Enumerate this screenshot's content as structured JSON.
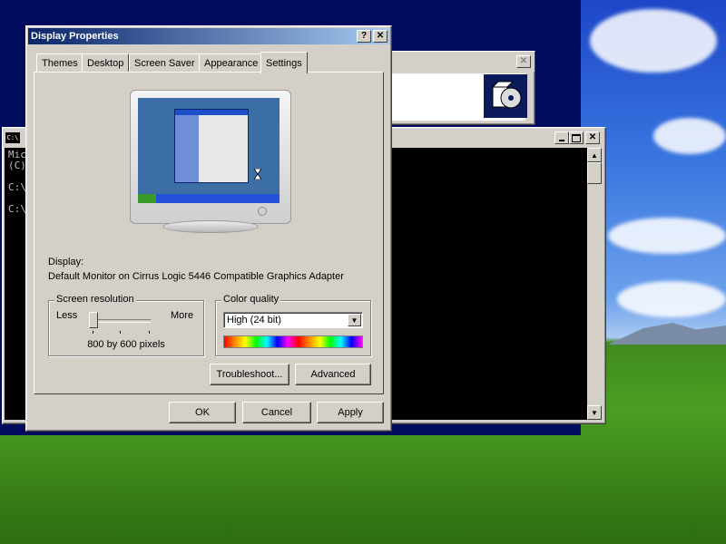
{
  "colors": {
    "title_active": "#0a246a",
    "face": "#d4d0c8",
    "console_bg": "#000000"
  },
  "dialog": {
    "title": "Display Properties",
    "help_btn": "?",
    "close_btn": "✕",
    "tabs": [
      "Themes",
      "Desktop",
      "Screen Saver",
      "Appearance",
      "Settings"
    ],
    "active_tab": "Settings",
    "display_label": "Display:",
    "display_value": "Default Monitor on Cirrus Logic 5446 Compatible Graphics Adapter",
    "resolution": {
      "group_label": "Screen resolution",
      "less": "Less",
      "more": "More",
      "value": "800 by 600 pixels",
      "slider_position": 0
    },
    "color": {
      "group_label": "Color quality",
      "selected": "High (24 bit)"
    },
    "buttons": {
      "troubleshoot": "Troubleshoot...",
      "advanced": "Advanced",
      "ok": "OK",
      "cancel": "Cancel",
      "apply": "Apply"
    }
  },
  "console": {
    "lines": [
      "Mic",
      "(C)",
      "",
      "C:\\",
      "",
      "C:\\"
    ],
    "title_icon": "C:\\"
  },
  "background_window": {
    "close_btn": "✕"
  }
}
